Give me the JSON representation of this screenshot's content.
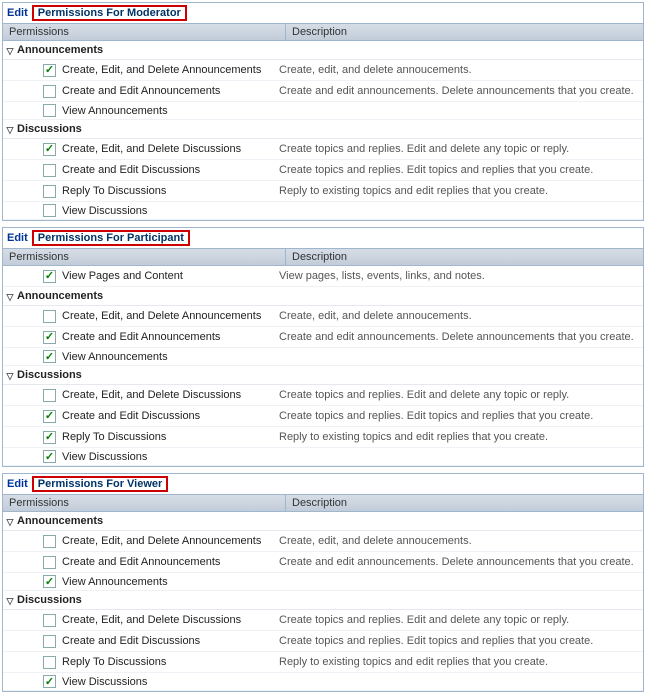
{
  "header_permissions": "Permissions",
  "header_description": "Description",
  "edit_label": "Edit",
  "blocks": [
    {
      "title": "Permissions For Moderator",
      "top_rows": [],
      "sections": [
        {
          "name": "Announcements",
          "rows": [
            {
              "label": "Create, Edit, and Delete Announcements",
              "checked": true,
              "desc": "Create, edit, and delete annoucements."
            },
            {
              "label": "Create and Edit Announcements",
              "checked": false,
              "desc": "Create and edit announcements. Delete announcements that you create."
            },
            {
              "label": "View Announcements",
              "checked": false,
              "desc": ""
            }
          ]
        },
        {
          "name": "Discussions",
          "rows": [
            {
              "label": "Create, Edit, and Delete Discussions",
              "checked": true,
              "desc": "Create topics and replies. Edit and delete any topic or reply."
            },
            {
              "label": "Create and Edit Discussions",
              "checked": false,
              "desc": "Create topics and replies. Edit topics and replies that you create."
            },
            {
              "label": "Reply To Discussions",
              "checked": false,
              "desc": "Reply to existing topics and edit replies that you create."
            },
            {
              "label": "View Discussions",
              "checked": false,
              "desc": ""
            }
          ]
        }
      ]
    },
    {
      "title": "Permissions For Participant",
      "top_rows": [
        {
          "label": "View Pages and Content",
          "checked": true,
          "desc": "View pages, lists, events, links, and notes."
        }
      ],
      "sections": [
        {
          "name": "Announcements",
          "rows": [
            {
              "label": "Create, Edit, and Delete Announcements",
              "checked": false,
              "desc": "Create, edit, and delete annoucements."
            },
            {
              "label": "Create and Edit Announcements",
              "checked": true,
              "desc": "Create and edit announcements. Delete announcements that you create."
            },
            {
              "label": "View Announcements",
              "checked": true,
              "desc": ""
            }
          ]
        },
        {
          "name": "Discussions",
          "rows": [
            {
              "label": "Create, Edit, and Delete Discussions",
              "checked": false,
              "desc": "Create topics and replies. Edit and delete any topic or reply."
            },
            {
              "label": "Create and Edit Discussions",
              "checked": true,
              "desc": "Create topics and replies. Edit topics and replies that you create."
            },
            {
              "label": "Reply To Discussions",
              "checked": true,
              "desc": "Reply to existing topics and edit replies that you create."
            },
            {
              "label": "View Discussions",
              "checked": true,
              "desc": ""
            }
          ]
        }
      ]
    },
    {
      "title": "Permissions For Viewer",
      "top_rows": [],
      "sections": [
        {
          "name": "Announcements",
          "rows": [
            {
              "label": "Create, Edit, and Delete Announcements",
              "checked": false,
              "desc": "Create, edit, and delete annoucements."
            },
            {
              "label": "Create and Edit Announcements",
              "checked": false,
              "desc": "Create and edit announcements. Delete announcements that you create."
            },
            {
              "label": "View Announcements",
              "checked": true,
              "desc": ""
            }
          ]
        },
        {
          "name": "Discussions",
          "rows": [
            {
              "label": "Create, Edit, and Delete Discussions",
              "checked": false,
              "desc": "Create topics and replies. Edit and delete any topic or reply."
            },
            {
              "label": "Create and Edit Discussions",
              "checked": false,
              "desc": "Create topics and replies. Edit topics and replies that you create."
            },
            {
              "label": "Reply To Discussions",
              "checked": false,
              "desc": "Reply to existing topics and edit replies that you create."
            },
            {
              "label": "View Discussions",
              "checked": true,
              "desc": ""
            }
          ]
        }
      ]
    }
  ]
}
